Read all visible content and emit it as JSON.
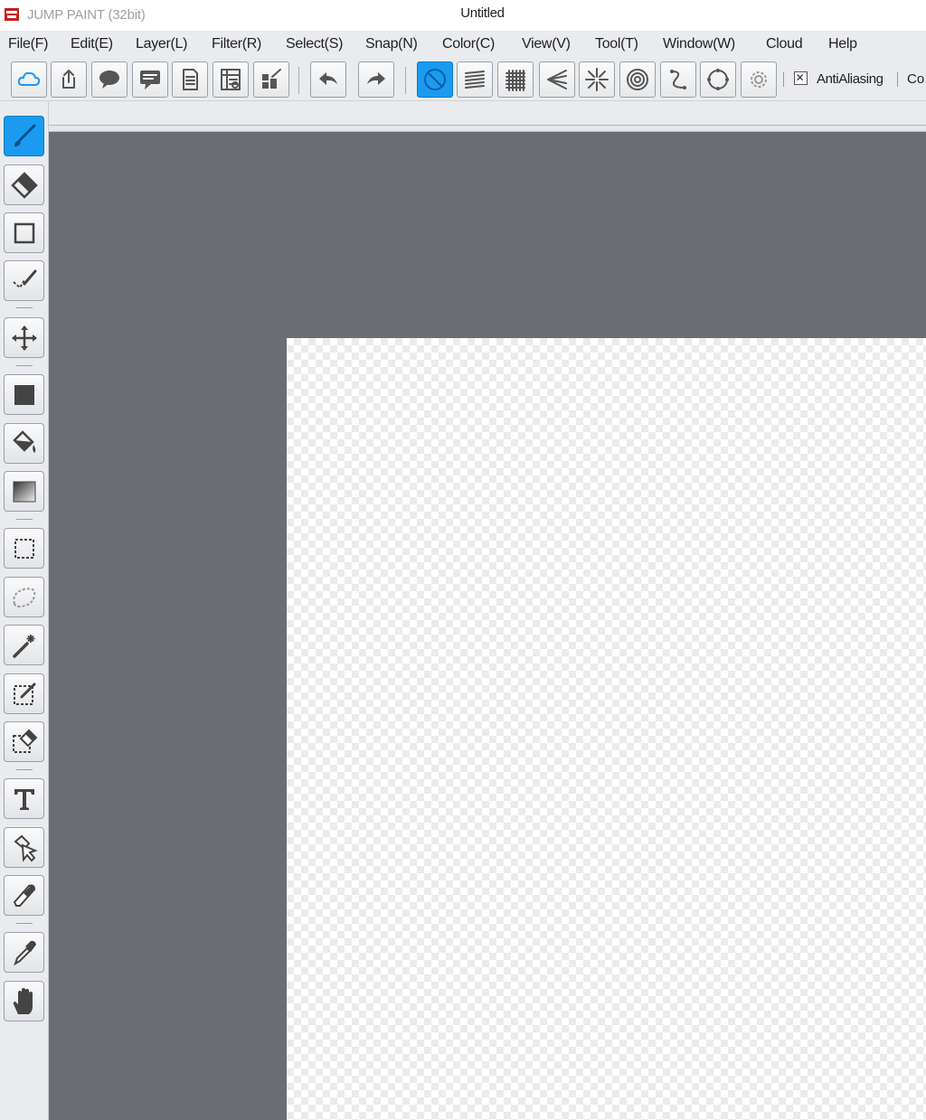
{
  "window": {
    "title": "JUMP PAINT (32bit)"
  },
  "menu": [
    "File(F)",
    "Edit(E)",
    "Layer(L)",
    "Filter(R)",
    "Select(S)",
    "Snap(N)",
    "Color(C)",
    "View(V)",
    "Tool(T)",
    "Window(W)",
    "Cloud",
    "Help"
  ],
  "toolbar": {
    "antialiasing_label": "AntiAliasing",
    "truncated_label": "Co",
    "buttons": [
      {
        "icon": "cloud-icon"
      },
      {
        "icon": "upload-icon"
      },
      {
        "icon": "speech-bubble-icon"
      },
      {
        "icon": "comment-icon"
      },
      {
        "icon": "document-icon"
      },
      {
        "icon": "frame-list-icon"
      },
      {
        "icon": "layout-edit-icon"
      },
      {
        "icon": "undo-icon"
      },
      {
        "icon": "redo-icon"
      },
      {
        "icon": "snap-off-icon",
        "active": true
      },
      {
        "icon": "parallel-lines-icon"
      },
      {
        "icon": "grid-icon"
      },
      {
        "icon": "perspective-icon"
      },
      {
        "icon": "radial-lines-icon"
      },
      {
        "icon": "concentric-circles-icon"
      },
      {
        "icon": "curve-icon"
      },
      {
        "icon": "circle-icon"
      },
      {
        "icon": "gear-icon"
      }
    ]
  },
  "tools": [
    {
      "icon": "brush-icon",
      "active": true
    },
    {
      "icon": "eraser-icon"
    },
    {
      "icon": "rectangle-icon"
    },
    {
      "icon": "polyline-pen-icon"
    },
    {
      "icon": "move-icon"
    },
    {
      "icon": "fill-rectangle-icon"
    },
    {
      "icon": "paint-bucket-icon"
    },
    {
      "icon": "gradient-icon"
    },
    {
      "icon": "rect-select-icon"
    },
    {
      "icon": "lasso-select-icon"
    },
    {
      "icon": "magic-wand-icon"
    },
    {
      "icon": "select-pen-icon"
    },
    {
      "icon": "select-eraser-icon"
    },
    {
      "icon": "text-icon"
    },
    {
      "icon": "object-select-icon"
    },
    {
      "icon": "knife-icon"
    },
    {
      "icon": "eyedropper-icon"
    },
    {
      "icon": "hand-icon"
    }
  ],
  "document": {
    "title": "Untitled"
  },
  "colors": {
    "accent": "#1a9bf0",
    "workspace": "#6a6d72",
    "chrome": "#e9ebee"
  }
}
